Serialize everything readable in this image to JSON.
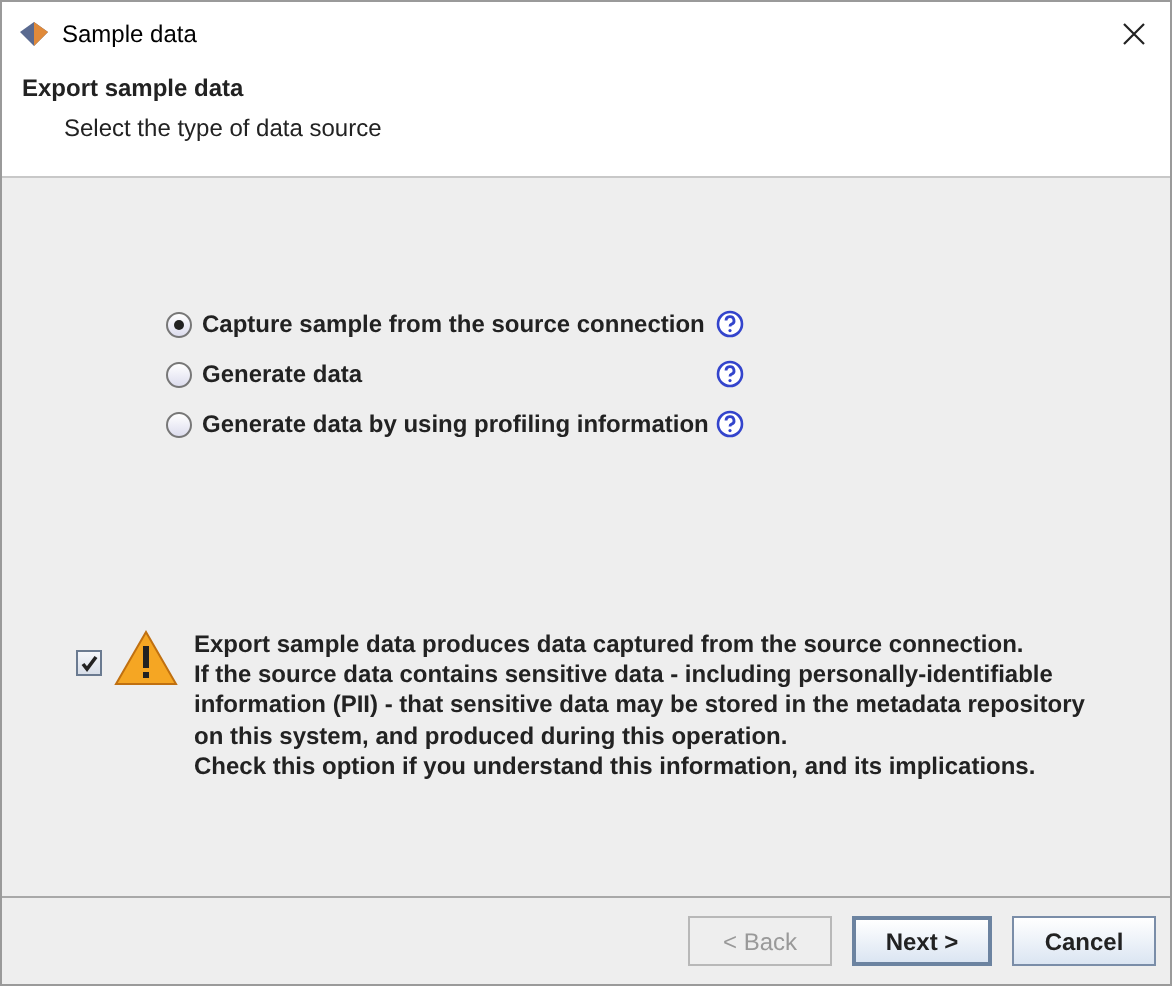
{
  "window": {
    "title": "Sample data"
  },
  "header": {
    "title": "Export sample data",
    "subtitle": "Select the type of data source"
  },
  "options": [
    {
      "label": "Capture sample from the source connection",
      "selected": true
    },
    {
      "label": "Generate data",
      "selected": false
    },
    {
      "label": "Generate data by using profiling information",
      "selected": false
    }
  ],
  "acknowledge": {
    "checked": true,
    "lines": [
      "Export sample data produces data captured from the source connection.",
      "If the source data contains sensitive data - including personally-identifiable",
      "information (PII) - that sensitive data may be stored in the metadata repository",
      "on this system, and produced during this operation.",
      "Check this option if you understand this information, and its implications."
    ]
  },
  "buttons": [
    {
      "label": "< Back",
      "disabled": true,
      "default": false
    },
    {
      "label": "Next >",
      "disabled": false,
      "default": true
    },
    {
      "label": "Cancel",
      "disabled": false,
      "default": false
    }
  ]
}
